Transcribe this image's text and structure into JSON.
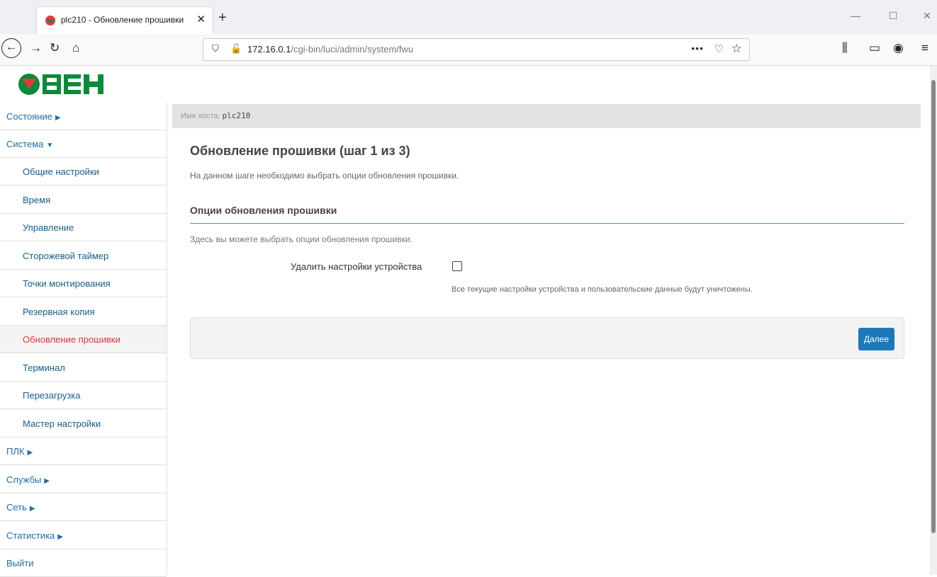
{
  "browser": {
    "tab_title": "plc210 - Обновление прошивки",
    "tab_close": "✕",
    "new_tab": "+",
    "url_host": "172.16.0.1",
    "url_path": "/cgi-bin/luci/admin/system/fwu",
    "more_actions": "•••",
    "window_controls": {
      "minimize": "—",
      "maximize": "☐",
      "close": "✕"
    },
    "icons": [
      "back-icon",
      "forward-icon",
      "reload-icon",
      "home-icon",
      "shield-icon",
      "insecure-lock-icon",
      "pocket-icon",
      "bookmark-star-icon",
      "library-icon",
      "sidebar-icon",
      "account-icon",
      "menu-icon"
    ]
  },
  "brand": {
    "logo_text": "ОВЕН",
    "logo_color": "#0a8a3a",
    "accent_red": "#e0393e"
  },
  "sidebar": {
    "items": [
      {
        "label": "Состояние",
        "type": "top",
        "caret": "▶"
      },
      {
        "label": "Система",
        "type": "top",
        "caret": "▼"
      },
      {
        "label": "Общие настройки",
        "type": "sub"
      },
      {
        "label": "Время",
        "type": "sub"
      },
      {
        "label": "Управление",
        "type": "sub"
      },
      {
        "label": "Сторожевой таймер",
        "type": "sub"
      },
      {
        "label": "Точки монтирования",
        "type": "sub"
      },
      {
        "label": "Резервная копия",
        "type": "sub"
      },
      {
        "label": "Обновление прошивки",
        "type": "sub",
        "active": true
      },
      {
        "label": "Терминал",
        "type": "sub"
      },
      {
        "label": "Перезагрузка",
        "type": "sub"
      },
      {
        "label": "Мастер настройки",
        "type": "sub"
      },
      {
        "label": "ПЛК",
        "type": "top",
        "caret": "▶"
      },
      {
        "label": "Службы",
        "type": "top",
        "caret": "▶"
      },
      {
        "label": "Сеть",
        "type": "top",
        "caret": "▶"
      },
      {
        "label": "Статистика",
        "type": "top",
        "caret": "▶"
      },
      {
        "label": "Выйти",
        "type": "top"
      }
    ]
  },
  "hostbar": {
    "label": "Имя хоста:",
    "hostname": "plc210"
  },
  "main": {
    "title": "Обновление прошивки (шаг 1 из 3)",
    "description": "На данном шаге необходимо выбрать опции обновления прошивки.",
    "section_title": "Опции обновления прошивки",
    "section_description": "Здесь вы можете выбрать опции обновления прошивки.",
    "option_label": "Удалить настройки устройства",
    "option_checked": false,
    "option_hint": "Все текущие настройки устройства и пользовательские данные будут уничтожены.",
    "next_button": "Далее"
  }
}
